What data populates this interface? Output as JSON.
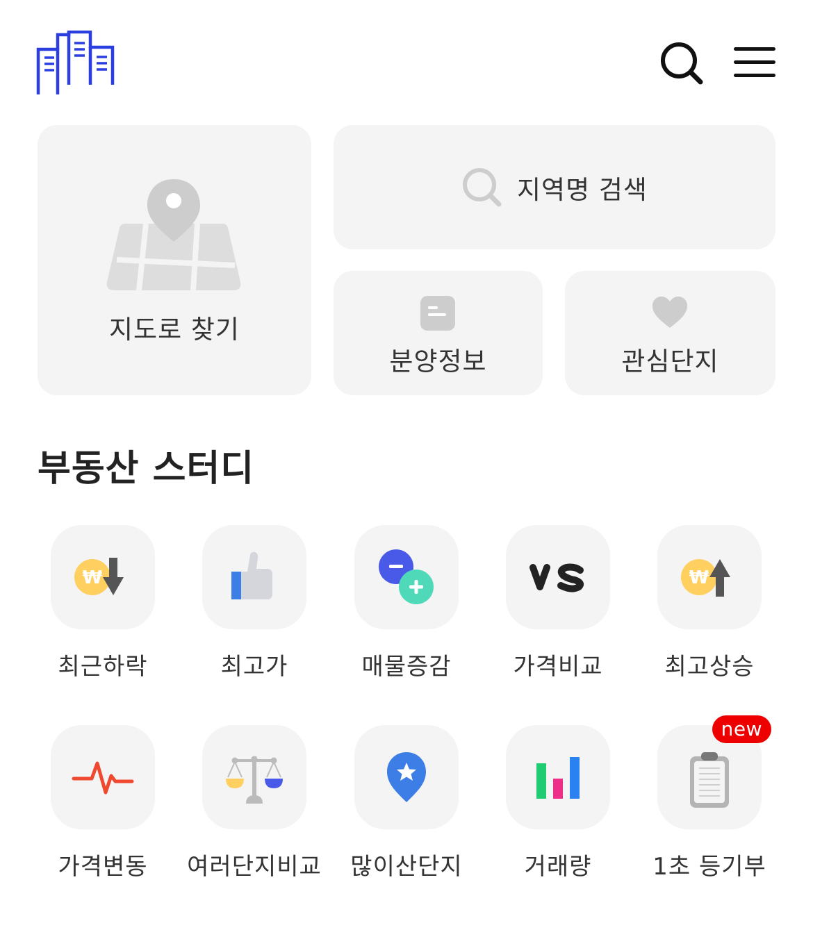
{
  "main": {
    "map_card": {
      "label": "지도로 찾기",
      "icon": "map-pin-icon"
    },
    "search_card": {
      "label": "지역명 검색",
      "icon": "search-icon"
    },
    "presale_card": {
      "label": "분양정보",
      "icon": "document-icon"
    },
    "favorites_card": {
      "label": "관심단지",
      "icon": "heart-icon"
    }
  },
  "study": {
    "title": "부동산 스터디",
    "items": [
      {
        "label": "최근하락",
        "icon": "won-down-icon"
      },
      {
        "label": "최고가",
        "icon": "thumbs-up-icon"
      },
      {
        "label": "매물증감",
        "icon": "plus-minus-icon"
      },
      {
        "label": "가격비교",
        "icon": "vs-icon"
      },
      {
        "label": "최고상승",
        "icon": "won-up-icon"
      },
      {
        "label": "가격변동",
        "icon": "pulse-icon"
      },
      {
        "label": "여러단지비교",
        "icon": "scale-icon"
      },
      {
        "label": "많이산단지",
        "icon": "star-pin-icon"
      },
      {
        "label": "거래량",
        "icon": "bar-chart-icon"
      },
      {
        "label": "1초 등기부",
        "icon": "clipboard-icon",
        "badge": "new"
      }
    ]
  },
  "colors": {
    "brand": "#2b3ee0",
    "badge": "#ef0000",
    "card_bg": "#f4f4f4"
  }
}
